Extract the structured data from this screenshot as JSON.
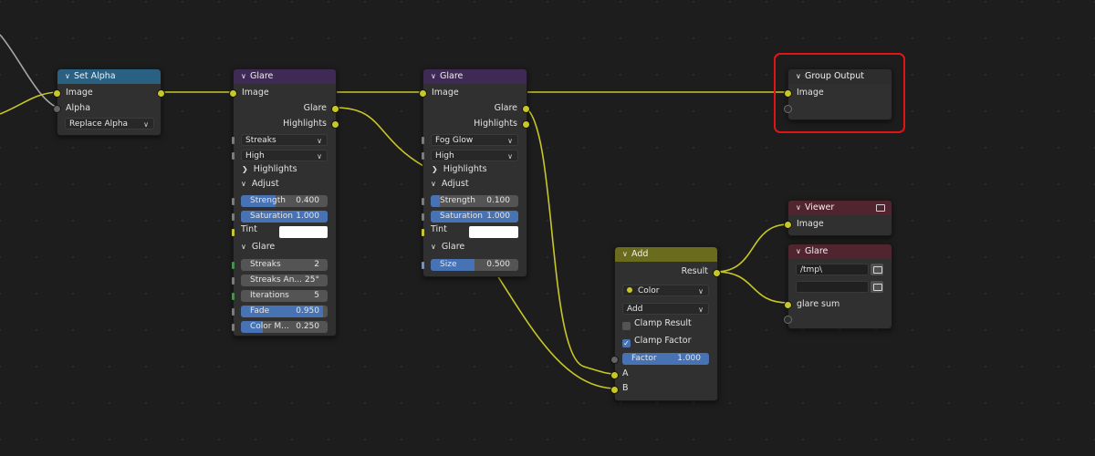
{
  "colors": {
    "set_alpha_header": "#2a6183",
    "glare_header": "#3f2a55",
    "output_header": "#2d2d2d",
    "add_header": "#6b6b1e",
    "viewer_header": "#512530",
    "file_output_header": "#512530",
    "socket_yellow": "#c7c729",
    "slider_blue": "#4772b3",
    "highlight_red": "#e01414"
  },
  "set_alpha": {
    "title": "Set Alpha",
    "out_image": "Image",
    "in_image": "Image",
    "in_alpha": "Alpha",
    "mode": "Replace Alpha"
  },
  "glare1": {
    "title": "Glare",
    "in_image": "Image",
    "out_glare": "Glare",
    "out_highlights": "Highlights",
    "type": "Streaks",
    "quality": "High",
    "highlights_panel": "Highlights",
    "adjust_panel": "Adjust",
    "strength_label": "Strength",
    "strength_value": "0.400",
    "strength_fill": 0.4,
    "saturation_label": "Saturation",
    "saturation_value": "1.000",
    "saturation_fill": 1.0,
    "tint_label": "Tint",
    "glare_panel": "Glare",
    "streaks_label": "Streaks",
    "streaks_value": "2",
    "angle_label": "Streaks An...",
    "angle_value": "25°",
    "iterations_label": "Iterations",
    "iterations_value": "5",
    "fade_label": "Fade",
    "fade_value": "0.950",
    "fade_fill": 0.95,
    "color_mod_label": "Color M...",
    "color_mod_value": "0.250",
    "color_mod_fill": 0.25
  },
  "glare2": {
    "title": "Glare",
    "in_image": "Image",
    "out_glare": "Glare",
    "out_highlights": "Highlights",
    "type": "Fog Glow",
    "quality": "High",
    "highlights_panel": "Highlights",
    "adjust_panel": "Adjust",
    "strength_label": "Strength",
    "strength_value": "0.100",
    "strength_fill": 0.1,
    "saturation_label": "Saturation",
    "saturation_value": "1.000",
    "saturation_fill": 1.0,
    "tint_label": "Tint",
    "glare_panel": "Glare",
    "size_label": "Size",
    "size_value": "0.500",
    "size_fill": 0.5
  },
  "group_output": {
    "title": "Group Output",
    "in_image": "Image"
  },
  "viewer": {
    "title": "Viewer",
    "in_image": "Image",
    "icon": "monitor-icon"
  },
  "file_output": {
    "title": "Glare",
    "path": "/tmp\\",
    "input": "glare sum"
  },
  "add_node": {
    "title": "Add",
    "out_result": "Result",
    "data_type": "Color",
    "operation": "Add",
    "clamp_result": "Clamp Result",
    "clamp_result_checked": false,
    "clamp_factor": "Clamp Factor",
    "clamp_factor_checked": true,
    "factor_label": "Factor",
    "factor_value": "1.000",
    "factor_fill": 1.0,
    "in_a": "A",
    "in_b": "B"
  }
}
